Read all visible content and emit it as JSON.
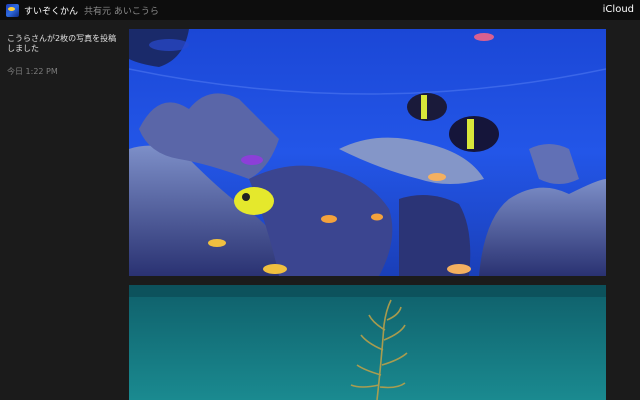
{
  "header": {
    "album_icon": "album-thumbnail-icon",
    "album_title": "すいぞくかん",
    "shared_by": "共有元 あいこうら",
    "brand": "iCloud"
  },
  "activity": {
    "message": "こうらさんが2枚の写真を投稿しました",
    "time": "今日 1:22 PM"
  },
  "photos": [
    {
      "subject": "aquarium-coral-reef-photo",
      "dominant_color": "#1f4fe0"
    },
    {
      "subject": "aquarium-seaweed-photo",
      "dominant_color": "#157a82"
    }
  ],
  "colors": {
    "topbar": "#0d0d0d",
    "background": "#1b1b1b",
    "text": "#e2e2e2",
    "muted_text": "#7d7d7d"
  }
}
